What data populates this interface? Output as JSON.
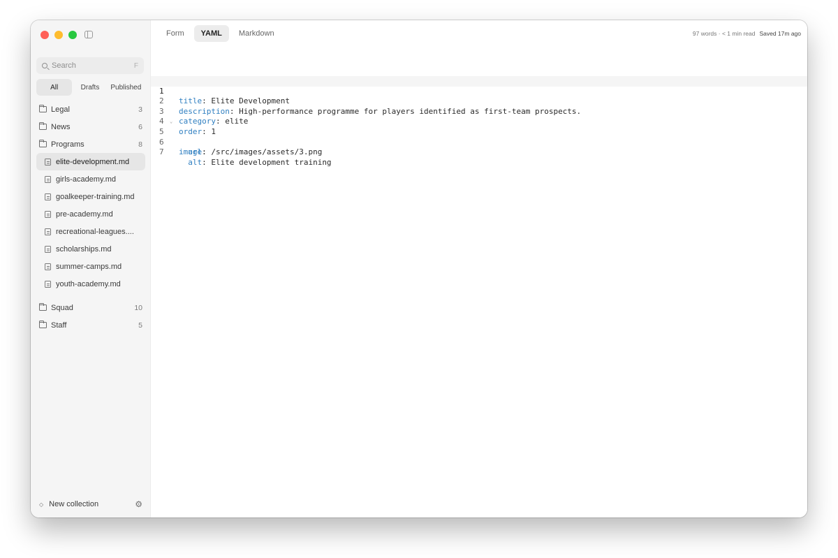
{
  "sidebar": {
    "search": {
      "placeholder": "Search",
      "shortcut": "F"
    },
    "filters": [
      "All",
      "Drafts",
      "Published"
    ],
    "folders": [
      {
        "label": "Legal",
        "count": "3"
      },
      {
        "label": "News",
        "count": "6"
      },
      {
        "label": "Programs",
        "count": "8"
      }
    ],
    "files": [
      "elite-development.md",
      "girls-academy.md",
      "goalkeeper-training.md",
      "pre-academy.md",
      "recreational-leagues....",
      "scholarships.md",
      "summer-camps.md",
      "youth-academy.md"
    ],
    "folders_after": [
      {
        "label": "Squad",
        "count": "10"
      },
      {
        "label": "Staff",
        "count": "5"
      }
    ],
    "footer": {
      "new_collection": "New collection"
    }
  },
  "tabs": [
    "Form",
    "YAML",
    "Markdown"
  ],
  "status": {
    "meta": "97 words · < 1 min read",
    "saved": "Saved 17m ago"
  },
  "editor": {
    "lines": [
      {
        "no": "1",
        "indent": "",
        "key": "title",
        "value": " Elite Development"
      },
      {
        "no": "2",
        "indent": "",
        "key": "description",
        "value": " High-performance programme for players identified as first-team prospects."
      },
      {
        "no": "3",
        "indent": "",
        "key": "category",
        "value": " elite"
      },
      {
        "no": "4",
        "indent": "",
        "key": "order",
        "value": " 1"
      },
      {
        "no": "5",
        "indent": "",
        "key": "image",
        "value": ""
      },
      {
        "no": "6",
        "indent": "  ",
        "key": "url",
        "value": " /src/images/assets/3.png"
      },
      {
        "no": "7",
        "indent": "  ",
        "key": "alt",
        "value": " Elite development training"
      }
    ]
  }
}
